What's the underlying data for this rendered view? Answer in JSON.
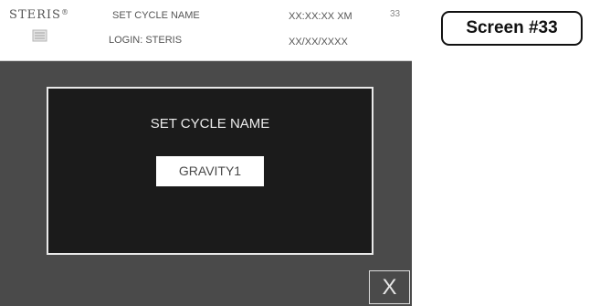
{
  "header": {
    "brand": "STERIS",
    "brand_mark": "®",
    "brand_emblem_icon": "steris-emblem-icon",
    "screen_title": "SET CYCLE NAME",
    "login": "LOGIN: STERIS",
    "time": "XX:XX:XX XM",
    "date": "XX/XX/XXXX",
    "screen_number": "33"
  },
  "dialog": {
    "title": "SET CYCLE NAME",
    "cycle_name_value": "GRAVITY1"
  },
  "close_button": {
    "label": "X",
    "icon": "close-icon"
  },
  "screen_tag": {
    "label": "Screen #33"
  },
  "colors": {
    "screen_background": "#4a4a4a",
    "dialog_background": "#1b1b1b",
    "header_background": "#ffffff",
    "text_light": "#ececec"
  }
}
